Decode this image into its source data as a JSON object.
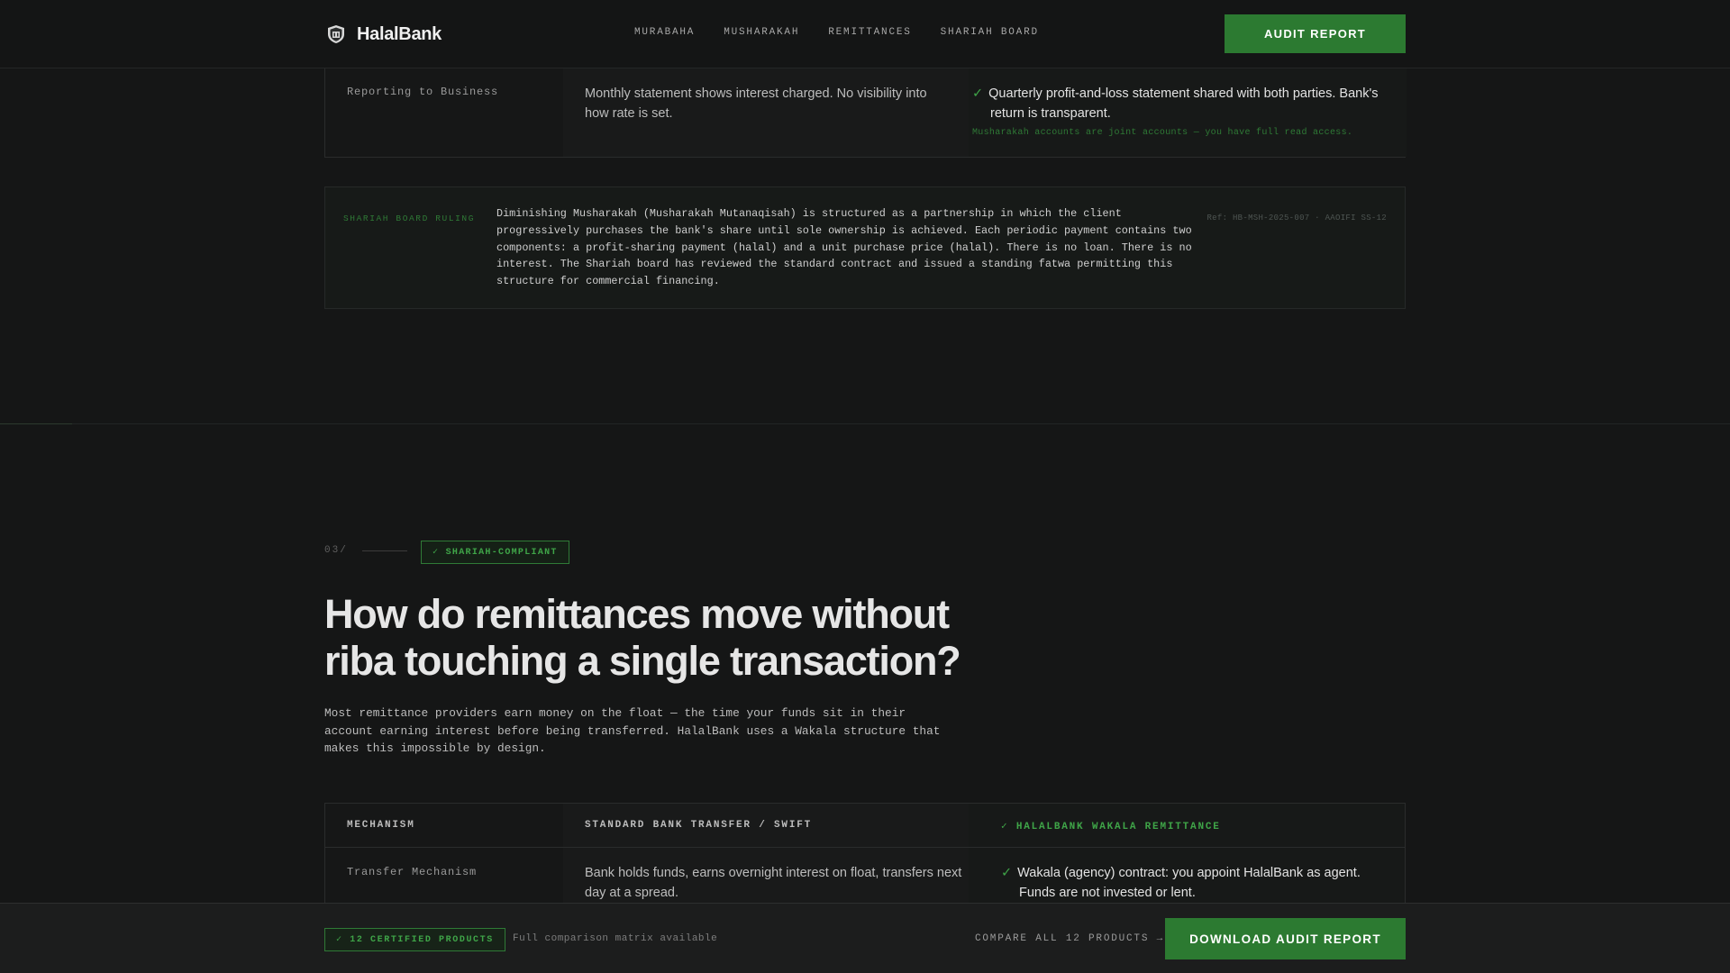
{
  "header": {
    "brand": "HalalBank",
    "nav": [
      "MURABAHA",
      "MUSHARAKAH",
      "REMITTANCES",
      "SHARIAH BOARD"
    ],
    "cta": "AUDIT REPORT"
  },
  "musharakah_table": {
    "row": {
      "label": "Reporting to Business",
      "standard": "Monthly statement shows interest charged. No visibility into how rate is set.",
      "halal": "Quarterly profit-and-loss statement shared with both parties. Bank's return is transparent.",
      "note": "Musharakah accounts are joint accounts — you have full read access."
    }
  },
  "ruling": {
    "label": "SHARIAH BOARD RULING",
    "body": "Diminishing Musharakah (Musharakah Mutanaqisah) is structured as a partnership in which the client progressively purchases the bank's share until sole ownership is achieved. Each periodic payment contains two components: a profit-sharing payment (halal) and a unit purchase price (halal). There is no loan. There is no interest. The Shariah board has reviewed the standard contract and issued a standing fatwa permitting this structure for commercial financing.",
    "ref": "Ref: HB-MSH-2025-007 · AAOIFI SS-12"
  },
  "section": {
    "number": "03/",
    "badge": "✓ SHARIAH-COMPLIANT",
    "title": "How do remittances move without riba touching a single transaction?",
    "lead": "Most remittance providers earn money on the float — the time your funds sit in their account earning interest before being transferred. HalalBank uses a Wakala structure that makes this impossible by design."
  },
  "remittance_table": {
    "headers": [
      "MECHANISM",
      "STANDARD BANK TRANSFER / SWIFT",
      "✓ HALALBANK WAKALA REMITTANCE"
    ],
    "rows": [
      {
        "label": "Transfer Mechanism",
        "standard": "Bank holds funds, earns overnight interest on float, transfers next day at a spread.",
        "halal": "Wakala (agency) contract: you appoint HalalBank as agent. Funds are not invested or lent."
      }
    ]
  },
  "footer": {
    "badge": "✓ 12 CERTIFIED PRODUCTS",
    "note": "Full comparison matrix available",
    "link": "COMPARE ALL 12 PRODUCTS →",
    "cta": "DOWNLOAD AUDIT REPORT"
  },
  "colors": {
    "background": "#151616",
    "accent_green": "#2c7a31",
    "check_green": "#3fa548"
  },
  "icons": {
    "brand": "shield-icon",
    "check": "check-icon"
  }
}
